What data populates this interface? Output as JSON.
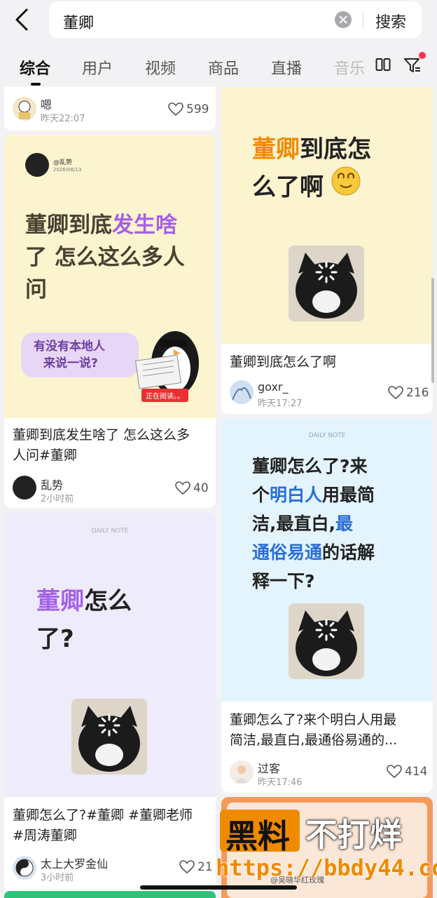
{
  "search": {
    "query": "董卿",
    "button_label": "搜索"
  },
  "tabs": [
    "综合",
    "用户",
    "视频",
    "商品",
    "直播",
    "音乐"
  ],
  "cards": {
    "c0": {
      "user": "嗯",
      "time": "昨天22:07",
      "likes": "599"
    },
    "c1": {
      "cover_handle": "@乱势",
      "cover_date": "2026/08/13",
      "cover_line1_a": "董卿到底",
      "cover_line1_b": "发生啥",
      "cover_line2": "了 怎么这么多人",
      "cover_line3": "问",
      "bubble_line1": "有没有本地人",
      "bubble_line2": "来说一说?",
      "paper_label": "正在阅读。。",
      "title_line1": "董卿到底发生啥了 怎么这么多",
      "title_line2": "人问#董卿",
      "user": "乱势",
      "time": "2小时前",
      "likes": "40"
    },
    "c2": {
      "cover_tag": "DAILY NOTE",
      "cover_line1_a": "董卿",
      "cover_line1_b": "怎么",
      "cover_line2": "了?",
      "title_line1": "董卿怎么了?#董卿 #董卿老师",
      "title_line2": "#周涛董卿",
      "user": "太上大罗金仙",
      "time": "3小时前",
      "likes": "21"
    },
    "c3": {
      "cover_line1_a": "董卿",
      "cover_line1_b": "到底怎",
      "cover_line2": "么了啊",
      "title": "董卿到底怎么了啊",
      "user": "goxr_",
      "time": "昨天17:27",
      "likes": "216"
    },
    "c4": {
      "cover_tag": "DAILY NOTE",
      "cover_line1": "董卿怎么了?来",
      "cover_line2_a": "个",
      "cover_line2_b": "明白人",
      "cover_line2_c": "用最简",
      "cover_line3_a": "洁,最直白,",
      "cover_line3_b": "最",
      "cover_line4_a": "通俗易通",
      "cover_line4_b": "的话解",
      "cover_line5": "释一下?",
      "title_line1": "董卿怎么了?来个明白人用最",
      "title_line2": "简洁,最直白,最通俗易通的...",
      "user": "过客",
      "time": "昨天17:46",
      "likes": "414"
    },
    "c5": {
      "handle": "@吴晓华红玫瑰"
    }
  },
  "watermark": {
    "text_a": "黑料",
    "text_b": "不打烊",
    "url": "https://bbdy44.com"
  },
  "colors": {
    "purple": "#a560e8",
    "orange": "#f08a00",
    "blue": "#2a6ed8",
    "yellow_bg": "#fbf4cf"
  }
}
